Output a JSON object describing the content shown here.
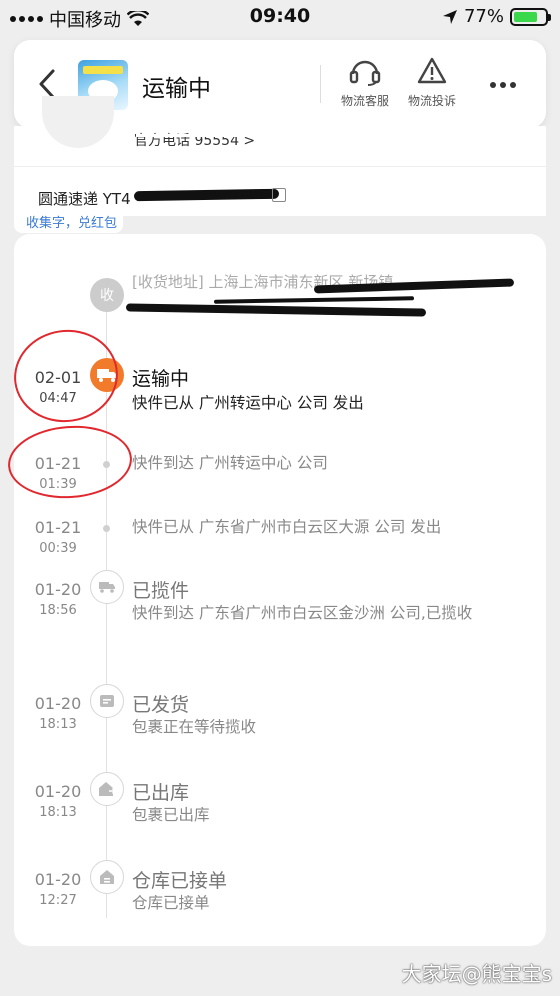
{
  "status_bar": {
    "carrier": "中国移动",
    "time": "09:40",
    "battery_percent": "77%",
    "battery_level": 0.77
  },
  "header": {
    "title": "运输中",
    "logistics_service_label": "物流客服",
    "logistics_complaint_label": "物流投诉"
  },
  "courier": {
    "phone_partial": "官方电话 95554 >",
    "tracking_label": "圆通速递 YT4",
    "collect_tag": "收集字，兑红包"
  },
  "timeline": {
    "address_label": "[收货地址] 上海上海市浦东新区 新场镇",
    "address_node_label": "收",
    "entries": [
      {
        "date": "02-01",
        "time": "04:47",
        "title": "运输中",
        "desc": "快件已从 广州转运中心 公司 发出"
      },
      {
        "date": "01-21",
        "time": "01:39",
        "title": "",
        "desc": "快件到达 广州转运中心 公司"
      },
      {
        "date": "01-21",
        "time": "00:39",
        "title": "",
        "desc": "快件已从 广东省广州市白云区大源 公司 发出"
      },
      {
        "date": "01-20",
        "time": "18:56",
        "title": "已揽件",
        "desc": "快件到达 广东省广州市白云区金沙洲 公司,已揽收"
      },
      {
        "date": "01-20",
        "time": "18:13",
        "title": "已发货",
        "desc": "包裹正在等待揽收"
      },
      {
        "date": "01-20",
        "time": "18:13",
        "title": "已出库",
        "desc": "包裹已出库"
      },
      {
        "date": "01-20",
        "time": "12:27",
        "title": "仓库已接单",
        "desc": "仓库已接单"
      }
    ]
  },
  "watermark": "大家坛@熊宝宝s",
  "colors": {
    "accent_orange": "#f27a2b",
    "annotation_red": "#e0282e",
    "link_blue": "#3b7bd4",
    "battery_green": "#3bd84b"
  }
}
